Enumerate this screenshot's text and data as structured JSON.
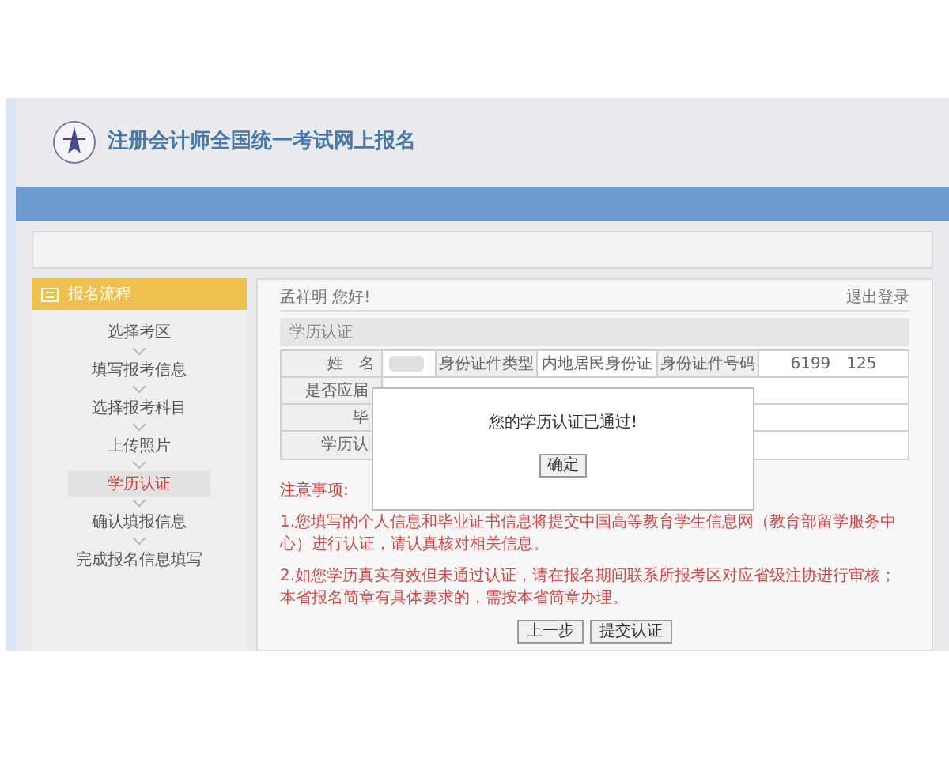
{
  "header": {
    "title": "注册会计师全国统一考试网上报名"
  },
  "sidebar": {
    "title": "报名流程",
    "items": [
      {
        "label": "选择考区",
        "selected": false
      },
      {
        "label": "填写报考信息",
        "selected": false
      },
      {
        "label": "选择报考科目",
        "selected": false
      },
      {
        "label": "上传照片",
        "selected": false
      },
      {
        "label": "学历认证",
        "selected": true
      },
      {
        "label": "确认填报信息",
        "selected": false
      },
      {
        "label": "完成报名信息填写",
        "selected": false
      }
    ]
  },
  "main": {
    "greeting": "孟祥明 您好!",
    "logout": "退出登录",
    "section_title": "学历认证",
    "table": {
      "rows": [
        {
          "cells": [
            "姓　名",
            "",
            "身份证件类型",
            "内地居民身份证",
            "身份证件号码",
            "6199　125"
          ]
        },
        {
          "cells": [
            "是否应届"
          ]
        },
        {
          "cells": [
            "毕"
          ]
        },
        {
          "cells": [
            "学历认"
          ]
        }
      ]
    },
    "notes_title": "注意事项:",
    "notes": [
      "1.您填写的个人信息和毕业证书信息将提交中国高等教育学生信息网（教育部留学服务中心）进行认证，请认真核对相关信息。",
      "2.如您学历真实有效但未通过认证，请在报名期间联系所报考区对应省级注协进行审核；本省报名简章有具体要求的，需按本省简章办理。"
    ],
    "buttons": [
      "上一步",
      "提交认证"
    ]
  },
  "dialog": {
    "message": "您的学历认证已通过!",
    "button": "确定"
  }
}
